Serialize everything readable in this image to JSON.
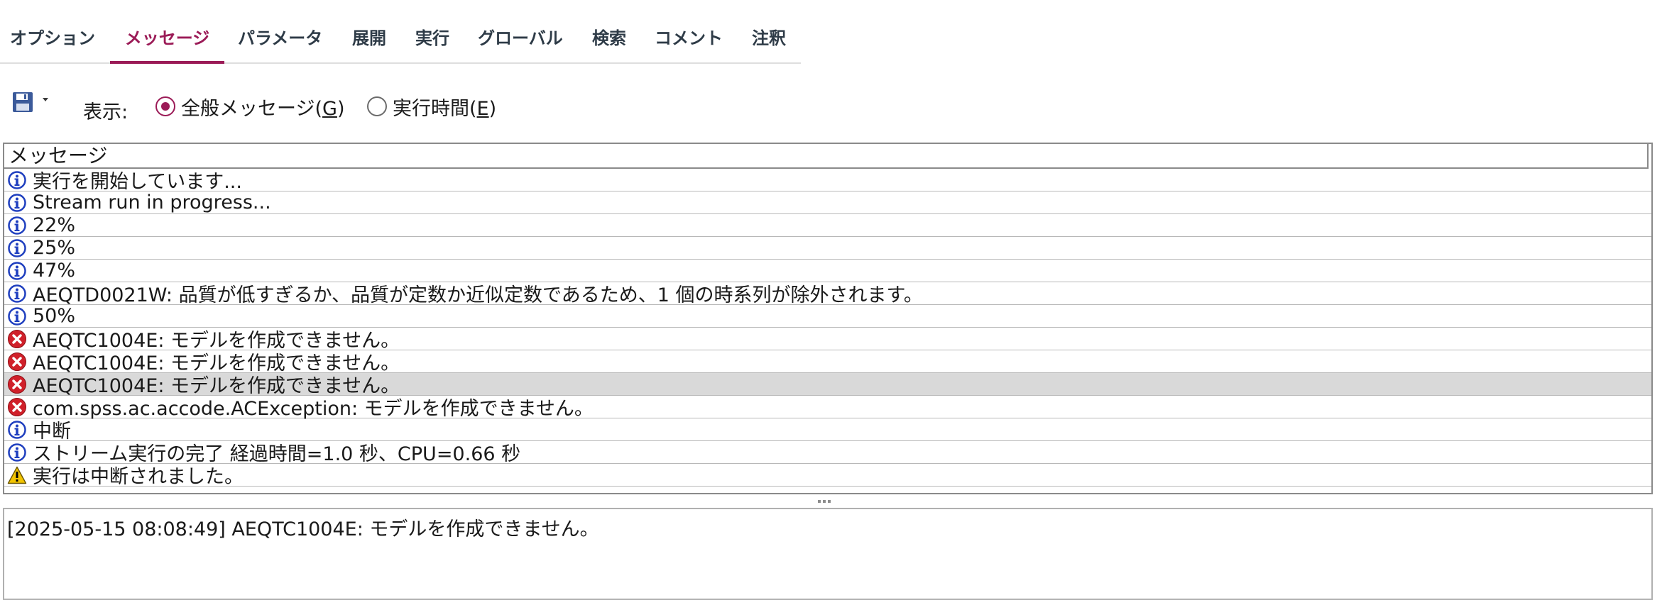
{
  "tabs": [
    {
      "label": "オプション",
      "active": false
    },
    {
      "label": "メッセージ",
      "active": true
    },
    {
      "label": "パラメータ",
      "active": false
    },
    {
      "label": "展開",
      "active": false
    },
    {
      "label": "実行",
      "active": false
    },
    {
      "label": "グローバル",
      "active": false
    },
    {
      "label": "検索",
      "active": false
    },
    {
      "label": "コメント",
      "active": false
    },
    {
      "label": "注釈",
      "active": false
    }
  ],
  "toolbar": {
    "save_icon": "save-icon",
    "display_label": "表示:",
    "radio_general": {
      "text": "全般メッセージ(",
      "mnemonic": "G",
      "close": ")",
      "checked": true
    },
    "radio_timing": {
      "text": "実行時間(",
      "mnemonic": "E",
      "close": ")",
      "checked": false
    }
  },
  "table": {
    "header": "メッセージ",
    "rows": [
      {
        "type": "info",
        "text": "実行を開始しています..."
      },
      {
        "type": "info",
        "text": "Stream run in progress..."
      },
      {
        "type": "info",
        "text": "22%"
      },
      {
        "type": "info",
        "text": "25%"
      },
      {
        "type": "info",
        "text": "47%"
      },
      {
        "type": "info",
        "text": "AEQTD0021W: 品質が低すぎるか、品質が定数か近似定数であるため、1 個の時系列が除外されます。"
      },
      {
        "type": "info",
        "text": "50%"
      },
      {
        "type": "error",
        "text": "AEQTC1004E: モデルを作成できません。"
      },
      {
        "type": "error",
        "text": "AEQTC1004E: モデルを作成できません。"
      },
      {
        "type": "error",
        "text": "AEQTC1004E: モデルを作成できません。",
        "selected": true
      },
      {
        "type": "error",
        "text": "com.spss.ac.accode.ACException: モデルを作成できません。"
      },
      {
        "type": "info",
        "text": "中断"
      },
      {
        "type": "info",
        "text": "ストリーム実行の完了 経過時間=1.0 秒、CPU=0.66 秒"
      },
      {
        "type": "warning",
        "text": "実行は中断されました。"
      }
    ]
  },
  "detail": {
    "text": "[2025-05-15 08:08:49] AEQTC1004E: モデルを作成できません。"
  },
  "colors": {
    "accent": "#9b1b57",
    "info": "#1f3fbf",
    "error": "#d0202a",
    "warning": "#f2c400"
  }
}
